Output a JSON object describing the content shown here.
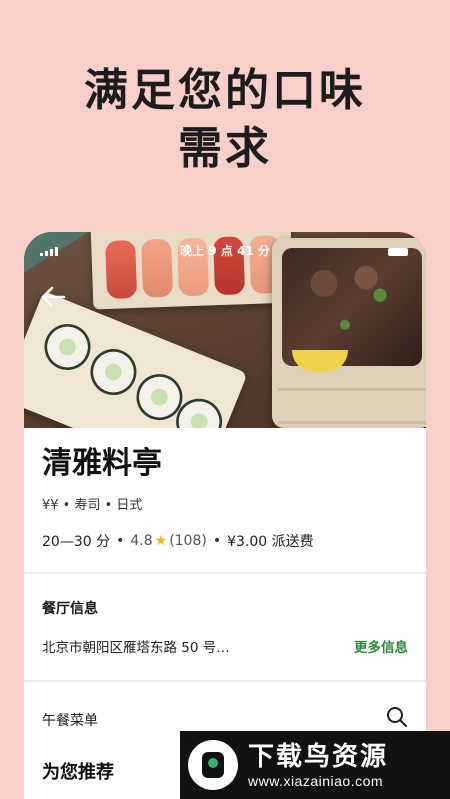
{
  "headline": {
    "line1": "满足您的口味",
    "line2": "需求"
  },
  "status_bar": {
    "time": "晚上 9 点 41 分"
  },
  "restaurant": {
    "name": "清雅料亭",
    "tags": "¥¥ • 寿司 • 日式",
    "delivery_time": "20—30 分",
    "rating": "4.8",
    "review_count": "(108)",
    "delivery_fee": "¥3.00 派送费"
  },
  "info_section": {
    "title": "餐厅信息",
    "address": "北京市朝阳区雁塔东路 50 号…",
    "more_label": "更多信息"
  },
  "menu_section": {
    "label": "午餐菜单",
    "recommend_title": "为您推荐"
  },
  "watermark": {
    "title": "下载鸟资源",
    "url": "www.xiazainiao.com"
  },
  "colors": {
    "background": "#f9cfc9",
    "accent_green": "#2e8b3e",
    "star": "#f1b80c"
  }
}
